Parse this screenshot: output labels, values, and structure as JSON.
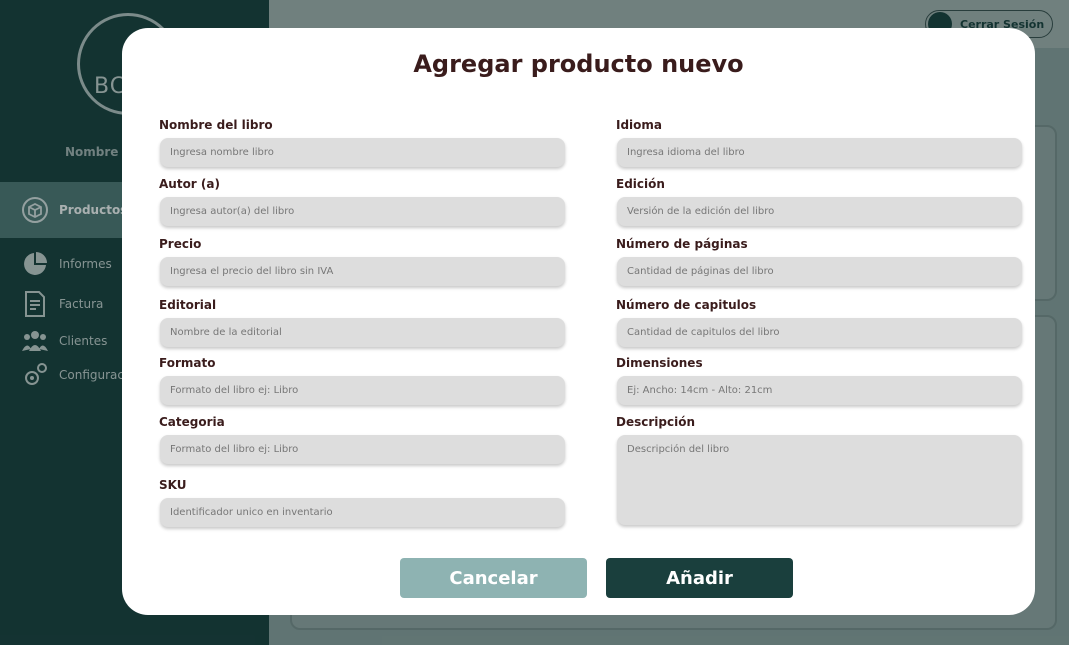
{
  "sidebar": {
    "logo_text": "BC",
    "store_name": "Nombre de la tienda",
    "items": [
      {
        "label": "Productos",
        "icon": "box-icon"
      },
      {
        "label": "Informes",
        "icon": "pie-chart-icon"
      },
      {
        "label": "Factura",
        "icon": "invoice-icon"
      },
      {
        "label": "Clientes",
        "icon": "users-icon"
      },
      {
        "label": "Configuración",
        "icon": "gear-icon"
      }
    ]
  },
  "header": {
    "logout_label": "Cerrar Sesión"
  },
  "modal": {
    "title": "Agregar producto nuevo",
    "left_fields": [
      {
        "label": "Nombre del libro",
        "placeholder": "Ingresa nombre libro"
      },
      {
        "label": "Autor (a)",
        "placeholder": "Ingresa autor(a) del libro"
      },
      {
        "label": "Precio",
        "placeholder": "Ingresa el precio del libro sin IVA"
      },
      {
        "label": "Editorial",
        "placeholder": "Nombre de la editorial"
      },
      {
        "label": "Formato",
        "placeholder": "Formato del libro ej: Libro"
      },
      {
        "label": "Categoria",
        "placeholder": "Formato del libro ej: Libro"
      },
      {
        "label": "SKU",
        "placeholder": "Identificador unico en inventario"
      }
    ],
    "right_fields": [
      {
        "label": "Idioma",
        "placeholder": "Ingresa idioma del libro"
      },
      {
        "label": "Edición",
        "placeholder": "Versión de la edición del libro"
      },
      {
        "label": "Número de páginas",
        "placeholder": "Cantidad de páginas del libro"
      },
      {
        "label": "Número de capitulos",
        "placeholder": "Cantidad de capitulos del libro"
      },
      {
        "label": "Dimensiones",
        "placeholder": "Ej: Ancho: 14cm - Alto: 21cm"
      },
      {
        "label": "Descripción",
        "placeholder": "Descripción del libro"
      }
    ],
    "cancel_label": "Cancelar",
    "add_label": "Añadir"
  },
  "colors": {
    "sidebar_bg": "#1a3f3d",
    "accent_dark": "#1a3f3d",
    "cancel_bg": "#8eb3b2",
    "title_color": "#3a1c1c"
  }
}
